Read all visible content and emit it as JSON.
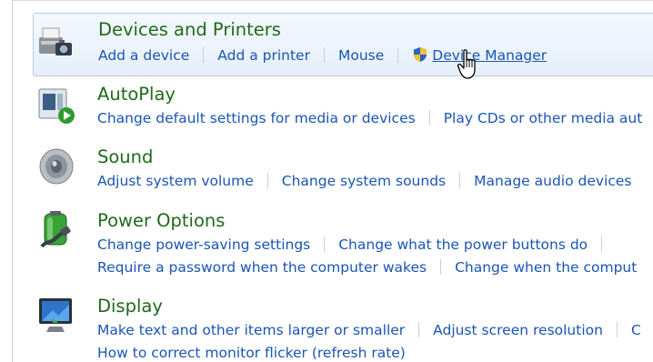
{
  "sections": [
    {
      "title": "Devices and Printers",
      "icon": "printer-camera-icon",
      "links": [
        "Add a device",
        "Add a printer",
        "Mouse",
        "Device Manager"
      ]
    },
    {
      "title": "AutoPlay",
      "icon": "autoplay-icon",
      "links": [
        "Change default settings for media or devices",
        "Play CDs or other media aut"
      ]
    },
    {
      "title": "Sound",
      "icon": "speaker-icon",
      "links": [
        "Adjust system volume",
        "Change system sounds",
        "Manage audio devices"
      ]
    },
    {
      "title": "Power Options",
      "icon": "battery-plug-icon",
      "links_row1": [
        "Change power-saving settings",
        "Change what the power buttons do"
      ],
      "links_row2": [
        "Require a password when the computer wakes",
        "Change when the comput"
      ]
    },
    {
      "title": "Display",
      "icon": "monitor-icon",
      "links_row1": [
        "Make text and other items larger or smaller",
        "Adjust screen resolution",
        "C"
      ],
      "links_row2": [
        "How to correct monitor flicker (refresh rate)"
      ]
    }
  ],
  "colors": {
    "title": "#1e6b1a",
    "link": "#1a55b4",
    "highlight_border": "#b7cbe3"
  },
  "cursor": "hand-pointer-icon",
  "shield_icon": "uac-shield-icon"
}
